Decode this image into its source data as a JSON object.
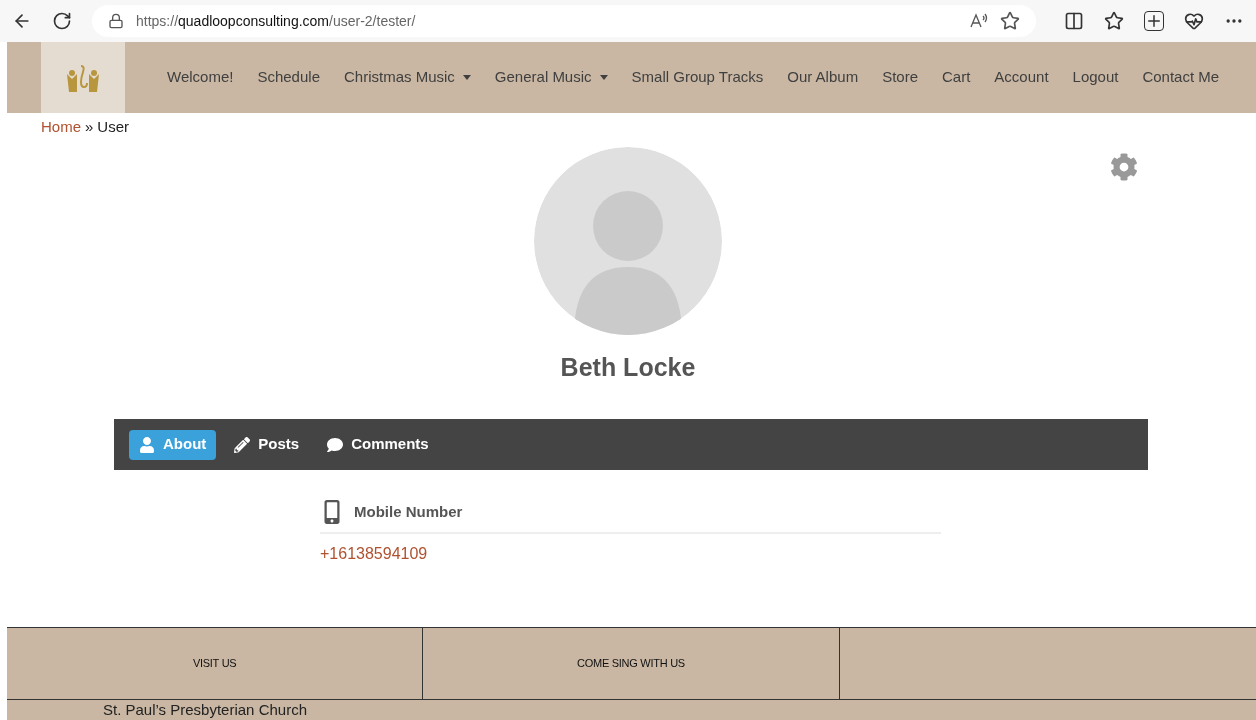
{
  "browser": {
    "url_scheme": "https://",
    "url_domain": "quadloopconsulting.com",
    "url_path": "/user-2/tester/"
  },
  "nav": [
    {
      "label": "Welcome!",
      "dropdown": false
    },
    {
      "label": "Schedule",
      "dropdown": false
    },
    {
      "label": "Christmas Music",
      "dropdown": true
    },
    {
      "label": "General Music",
      "dropdown": true
    },
    {
      "label": "Small Group Tracks",
      "dropdown": false
    },
    {
      "label": "Our Album",
      "dropdown": false
    },
    {
      "label": "Store",
      "dropdown": false
    },
    {
      "label": "Cart",
      "dropdown": false
    },
    {
      "label": "Account",
      "dropdown": false
    },
    {
      "label": "Logout",
      "dropdown": false
    },
    {
      "label": "Contact Me",
      "dropdown": false
    }
  ],
  "breadcrumb": {
    "link": "Home",
    "separator": "»",
    "current": "User"
  },
  "profile": {
    "name": "Beth Locke"
  },
  "tabs": [
    {
      "label": "About",
      "kind": "user",
      "selected": true
    },
    {
      "label": "Posts",
      "kind": "pencil",
      "selected": false
    },
    {
      "label": "Comments",
      "kind": "comment",
      "selected": false
    }
  ],
  "field": {
    "label": "Mobile Number",
    "value": "+16138594109"
  },
  "footer": {
    "columns": [
      "VISIT US",
      "COME SING WITH US"
    ],
    "address": "St. Paul’s Presbyterian Church"
  }
}
